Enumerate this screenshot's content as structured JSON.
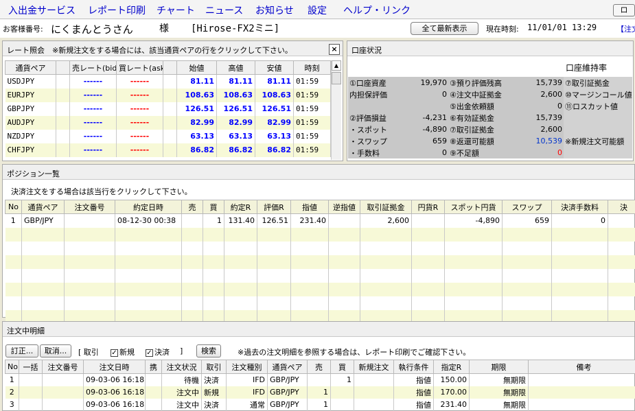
{
  "menu": [
    "入出金サービス",
    "レポート印刷",
    "チャート",
    "ニュース",
    "お知らせ",
    "設定",
    "ヘルプ・リンク"
  ],
  "exit_label": "ロ",
  "customer": {
    "label": "お客様番号:",
    "name": "にくまんとうさん",
    "sama": "様",
    "product": "[Hirose-FX2ミニ]",
    "refresh": "全て最新表示",
    "time_label": "現在時刻:",
    "time": "11/01/01 13:29",
    "note": "【注文"
  },
  "rate": {
    "title": "レート照会　※新規注文をする場合には、該当通貨ペアの行をクリックして下さい。",
    "close": "×",
    "headers": [
      "通貨ペア",
      "",
      "売レート(bid)",
      "買レート(ask)",
      "",
      "始値",
      "高値",
      "安値",
      "時刻"
    ],
    "rows": [
      {
        "pair": "USDJPY",
        "bid": "------",
        "ask": "------",
        "open": "81.11",
        "high": "81.11",
        "low": "81.11",
        "time": "01:59"
      },
      {
        "pair": "EURJPY",
        "bid": "------",
        "ask": "------",
        "open": "108.63",
        "high": "108.63",
        "low": "108.63",
        "time": "01:59"
      },
      {
        "pair": "GBPJPY",
        "bid": "------",
        "ask": "------",
        "open": "126.51",
        "high": "126.51",
        "low": "126.51",
        "time": "01:59"
      },
      {
        "pair": "AUDJPY",
        "bid": "------",
        "ask": "------",
        "open": "82.99",
        "high": "82.99",
        "low": "82.99",
        "time": "01:59"
      },
      {
        "pair": "NZDJPY",
        "bid": "------",
        "ask": "------",
        "open": "63.13",
        "high": "63.13",
        "low": "63.13",
        "time": "01:59"
      },
      {
        "pair": "CHFJPY",
        "bid": "------",
        "ask": "------",
        "open": "86.82",
        "high": "86.82",
        "low": "86.82",
        "time": "01:59"
      }
    ]
  },
  "account": {
    "title": "口座状況",
    "maintain": "口座維持率",
    "rows": [
      [
        "①口座資産",
        "19,970",
        "③預り評価残高",
        "15,739",
        "⑦取引証拠金"
      ],
      [
        "内担保評価",
        "0",
        "④注文中証拠金",
        "2,600",
        "⑩マージンコール値"
      ],
      [
        "",
        "",
        "⑤出金依頼額",
        "0",
        "⑪ロスカット値"
      ],
      [
        "②評価損益",
        "-4,231",
        "⑥有効証拠金",
        "15,739",
        ""
      ],
      [
        "・スポット",
        "-4,890",
        "⑦取引証拠金",
        "2,600",
        ""
      ],
      [
        "・スワップ",
        "659",
        "⑧返還可能額",
        "10,539",
        "※新規注文可能額"
      ],
      [
        "・手数料",
        "0",
        "⑨不足額",
        "0",
        ""
      ]
    ]
  },
  "positions": {
    "title": "ポジション一覧",
    "instruction": "決済注文をする場合は該当行をクリックして下さい。",
    "headers": [
      "No",
      "通貨ペア",
      "注文番号",
      "約定日時",
      "売",
      "買",
      "約定R",
      "評価R",
      "指値",
      "逆指値",
      "取引証拠金",
      "円貨R",
      "スポット円貨",
      "スワップ",
      "決済手数料",
      "決"
    ],
    "rows": [
      [
        "1",
        "GBP/JPY",
        "",
        "08-12-30 00:38",
        "",
        "1",
        "131.40",
        "126.51",
        "231.40",
        "",
        "2,600",
        "",
        "-4,890",
        "659",
        "0",
        ""
      ]
    ]
  },
  "orders": {
    "title": "注文中明細",
    "btn_edit": "訂正...",
    "btn_cancel": "取消...",
    "filter_open": "[ 取引",
    "chk_new": "新規",
    "chk_settle": "決済",
    "filter_close": "]",
    "btn_search": "検索",
    "note": "※過去の注文明細を参照する場合は、レポート印刷でご確認下さい。",
    "headers": [
      "No",
      "一括",
      "注文番号",
      "注文日時",
      "携",
      "注文状況",
      "取引",
      "注文種別",
      "通貨ペア",
      "売",
      "買",
      "新規注文",
      "執行条件",
      "指定R",
      "期限",
      "備考"
    ],
    "rows": [
      [
        "1",
        "",
        "",
        "09-03-06 16:18",
        "",
        "待機",
        "決済",
        "IFD",
        "GBP/JPY",
        "",
        "1",
        "",
        "指値",
        "150.00",
        "無期限",
        ""
      ],
      [
        "2",
        "",
        "",
        "09-03-06 16:18",
        "",
        "注文中",
        "新規",
        "IFD",
        "GBP/JPY",
        "1",
        "",
        "",
        "指値",
        "170.00",
        "無期限",
        ""
      ],
      [
        "3",
        "",
        "",
        "09-03-06 16:18",
        "",
        "注文中",
        "決済",
        "通常",
        "GBP/JPY",
        "1",
        "",
        "",
        "指値",
        "231.40",
        "無期限",
        ""
      ]
    ]
  }
}
